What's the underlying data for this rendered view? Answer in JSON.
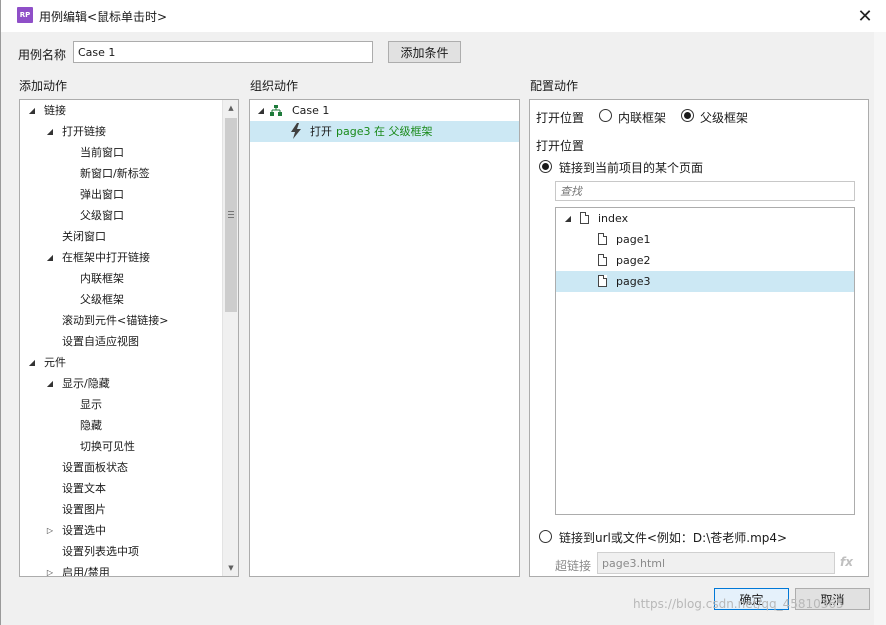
{
  "window": {
    "title": "用例编辑<鼠标单击时>",
    "logo_text": "RP",
    "close_glyph": "✕"
  },
  "case_name": {
    "label": "用例名称",
    "value": "Case 1",
    "add_condition_label": "添加条件"
  },
  "sections": {
    "add_action": "添加动作",
    "organize_action": "组织动作",
    "configure_action": "配置动作"
  },
  "action_tree": [
    {
      "label": "链接",
      "level": 0,
      "expanded": true
    },
    {
      "label": "打开链接",
      "level": 1,
      "expanded": true
    },
    {
      "label": "当前窗口",
      "level": 2
    },
    {
      "label": "新窗口/新标签",
      "level": 2
    },
    {
      "label": "弹出窗口",
      "level": 2
    },
    {
      "label": "父级窗口",
      "level": 2
    },
    {
      "label": "关闭窗口",
      "level": 1
    },
    {
      "label": "在框架中打开链接",
      "level": 1,
      "expanded": true
    },
    {
      "label": "内联框架",
      "level": 2
    },
    {
      "label": "父级框架",
      "level": 2
    },
    {
      "label": "滚动到元件<锚链接>",
      "level": 1
    },
    {
      "label": "设置自适应视图",
      "level": 1
    },
    {
      "label": "元件",
      "level": 0,
      "expanded": true
    },
    {
      "label": "显示/隐藏",
      "level": 1,
      "expanded": true
    },
    {
      "label": "显示",
      "level": 2
    },
    {
      "label": "隐藏",
      "level": 2
    },
    {
      "label": "切换可见性",
      "level": 2
    },
    {
      "label": "设置面板状态",
      "level": 1
    },
    {
      "label": "设置文本",
      "level": 1
    },
    {
      "label": "设置图片",
      "level": 1
    },
    {
      "label": "设置选中",
      "level": 1,
      "collapsed": true
    },
    {
      "label": "设置列表选中项",
      "level": 1
    },
    {
      "label": "启用/禁用",
      "level": 1,
      "collapsed": true
    }
  ],
  "organize": {
    "case_label": "Case 1",
    "action_prefix": "打开",
    "action_detail": "page3 在 父级框架"
  },
  "configure": {
    "open_in_label": "打开位置",
    "option_inline": "内联框架",
    "option_parent": "父级框架",
    "selected_option": "父级框架",
    "open_target_label": "打开位置",
    "link_page_label": "链接到当前项目的某个页面",
    "search_placeholder": "查找",
    "pages": [
      {
        "label": "index",
        "level": 0
      },
      {
        "label": "page1",
        "level": 1
      },
      {
        "label": "page2",
        "level": 1
      },
      {
        "label": "page3",
        "level": 1,
        "selected": true
      }
    ],
    "link_url_label": "链接到url或文件<例如：D:\\苍老师.mp4>",
    "hyperlink_label": "超链接",
    "hyperlink_value": "page3.html",
    "fx_label": "fx"
  },
  "buttons": {
    "ok": "确定",
    "cancel": "取消"
  },
  "watermark": "https://blog.csdn.net/qq_45810365",
  "colors": {
    "selection": "#cce8f4",
    "action_green": "#1a8a1a",
    "logo": "#8f4fc8"
  }
}
